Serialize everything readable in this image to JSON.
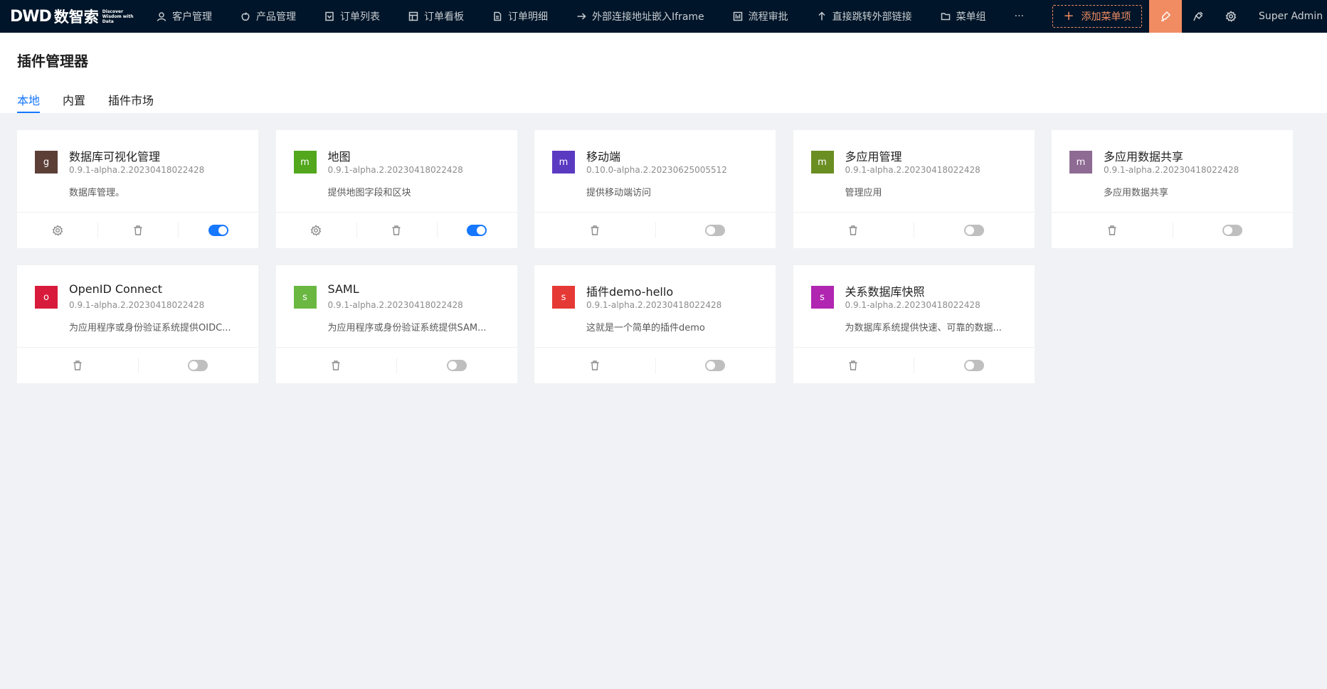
{
  "brand": {
    "mark": "DWD",
    "name": "数智索",
    "tagline": "Discover Wisdom with Data"
  },
  "nav": {
    "items": [
      {
        "label": "客户管理",
        "icon": "user-icon"
      },
      {
        "label": "产品管理",
        "icon": "apple-icon"
      },
      {
        "label": "订单列表",
        "icon": "form-icon"
      },
      {
        "label": "订单看板",
        "icon": "board-icon"
      },
      {
        "label": "订单明细",
        "icon": "file-icon"
      },
      {
        "label": "外部连接地址嵌入Iframe",
        "icon": "arrow-right-icon"
      },
      {
        "label": "流程审批",
        "icon": "workflow-icon"
      },
      {
        "label": "直接跳转外部链接",
        "icon": "arrow-up-icon"
      },
      {
        "label": "菜单组",
        "icon": "folder-icon"
      }
    ],
    "more": "···",
    "add_menu_label": "添加菜单项",
    "user_name": "Super Admin"
  },
  "page": {
    "title": "插件管理器",
    "tabs": [
      "本地",
      "内置",
      "插件市场"
    ]
  },
  "colors": {
    "accent": "#1677ff",
    "topbar": "#001529",
    "highlight": "#f18b62"
  },
  "plugins": [
    {
      "letter": "g",
      "color": "#5c4038",
      "name": "数据库可视化管理",
      "version": "0.9.1-alpha.2.20230418022428",
      "description": "数据库管理。",
      "has_settings": true,
      "enabled": true
    },
    {
      "letter": "m",
      "color": "#52a71d",
      "name": "地图",
      "version": "0.9.1-alpha.2.20230418022428",
      "description": "提供地图字段和区块",
      "has_settings": true,
      "enabled": true
    },
    {
      "letter": "m",
      "color": "#5b3ac2",
      "name": "移动端",
      "version": "0.10.0-alpha.2.20230625005512",
      "description": "提供移动端访问",
      "has_settings": false,
      "enabled": false
    },
    {
      "letter": "m",
      "color": "#6b8e23",
      "name": "多应用管理",
      "version": "0.9.1-alpha.2.20230418022428",
      "description": "管理应用",
      "has_settings": false,
      "enabled": false
    },
    {
      "letter": "m",
      "color": "#8e6b93",
      "name": "多应用数据共享",
      "version": "0.9.1-alpha.2.20230418022428",
      "description": "多应用数据共享",
      "has_settings": false,
      "enabled": false
    },
    {
      "letter": "o",
      "color": "#d81b3c",
      "name": "OpenID Connect",
      "version": "0.9.1-alpha.2.20230418022428",
      "description": "为应用程序或身份验证系统提供OIDC...",
      "has_settings": false,
      "enabled": false
    },
    {
      "letter": "s",
      "color": "#6ab842",
      "name": "SAML",
      "version": "0.9.1-alpha.2.20230418022428",
      "description": "为应用程序或身份验证系统提供SAM...",
      "has_settings": false,
      "enabled": false
    },
    {
      "letter": "s",
      "color": "#e53935",
      "name": "插件demo-hello",
      "version": "0.9.1-alpha.2.20230418022428",
      "description": "这就是一个简单的插件demo",
      "has_settings": false,
      "enabled": false
    },
    {
      "letter": "s",
      "color": "#b026b0",
      "name": "关系数据库快照",
      "version": "0.9.1-alpha.2.20230418022428",
      "description": "为数据库系统提供快速、可靠的数据...",
      "has_settings": false,
      "enabled": false
    }
  ]
}
